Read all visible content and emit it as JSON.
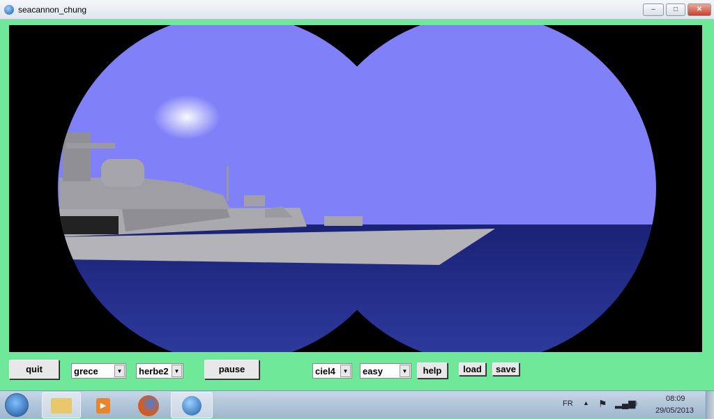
{
  "window": {
    "title": "seacannon_chung",
    "controls": {
      "minimize": "–",
      "maximize": "□",
      "close": "✕"
    }
  },
  "colors": {
    "background": "#6fe89a",
    "sky": "#8080f8",
    "sea": "#1e2a86",
    "ship": "#b4b4b8"
  },
  "controls": {
    "quit": "quit",
    "country_select": "grece",
    "terrain_select": "herbe2",
    "pause": "pause",
    "sky_select": "ciel4",
    "difficulty_select": "easy",
    "help": "help",
    "load": "load",
    "save": "save"
  },
  "taskbar": {
    "items": [
      {
        "icon": "windows-start-icon"
      },
      {
        "icon": "file-explorer-icon"
      },
      {
        "icon": "media-player-icon"
      },
      {
        "icon": "firefox-icon"
      },
      {
        "icon": "seacannon-app-icon"
      }
    ],
    "language": "FR",
    "time": "08:09",
    "date": "29/05/2013"
  }
}
